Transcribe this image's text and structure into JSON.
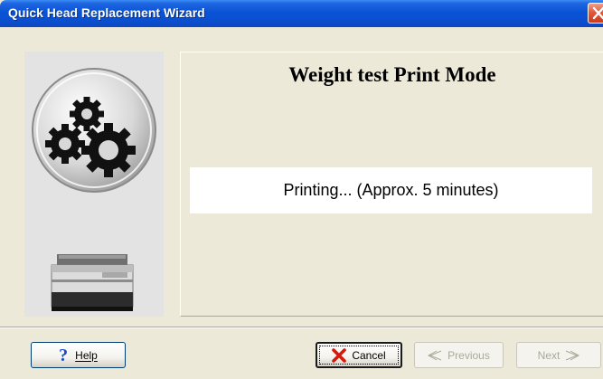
{
  "window": {
    "title": "Quick Head Replacement Wizard"
  },
  "icons": {
    "close": "close-icon",
    "gears": "gears-icon",
    "printer": "printer-icon",
    "help": "question-mark-icon",
    "cancel": "x-icon",
    "previous": "left-arrow-icon",
    "next": "right-arrow-icon"
  },
  "content": {
    "mode_title": "Weight test Print Mode",
    "status": "Printing... (Approx. 5 minutes)"
  },
  "buttons": {
    "help_label": "Help",
    "cancel_label": "Cancel",
    "previous_label": "Previous",
    "next_label": "Next",
    "previous_enabled": false,
    "next_enabled": false
  },
  "colors": {
    "titlebar": "#0a53d6",
    "window_bg": "#ece9d8",
    "close_button": "#e2593c",
    "cancel_icon": "#d41a0c",
    "help_icon": "#1450c8"
  }
}
